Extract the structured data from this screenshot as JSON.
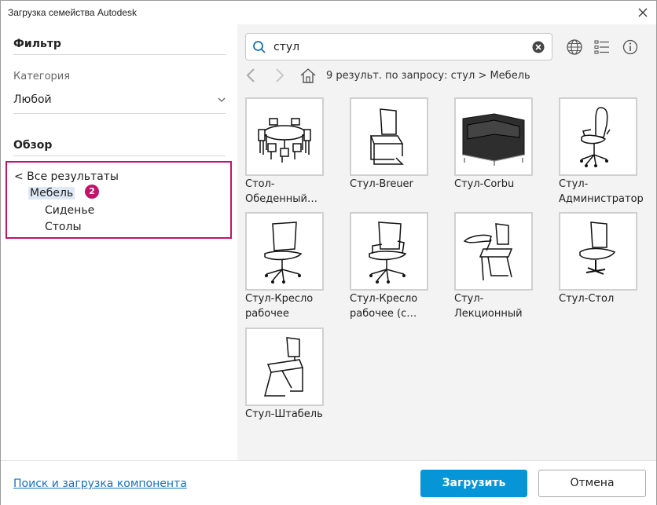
{
  "window": {
    "title": "Загрузка семейства Autodesk"
  },
  "filter": {
    "heading": "Фильтр",
    "category_label": "Категория",
    "category_value": "Любой"
  },
  "browse": {
    "heading": "Обзор",
    "all_results": "< Все результаты",
    "selected": "Мебель",
    "badge": "2",
    "children": [
      "Сиденье",
      "Столы"
    ]
  },
  "search": {
    "value": "стул",
    "placeholder": ""
  },
  "breadcrumb": "9 результ. по запросу: стул > Мебель",
  "results": [
    {
      "label": "Стол-Обеденный…",
      "icon": "dining-table"
    },
    {
      "label": "Стул-Breuer",
      "icon": "breuer-chair"
    },
    {
      "label": "Стул-Corbu",
      "icon": "corbu-armchair"
    },
    {
      "label": "Стул-Администратор",
      "icon": "admin-chair"
    },
    {
      "label": "Стул-Кресло рабочее",
      "icon": "task-chair"
    },
    {
      "label": "Стул-Кресло рабочее (с…",
      "icon": "task-chair-arms"
    },
    {
      "label": "Стул-Лекционный",
      "icon": "lecture-chair"
    },
    {
      "label": "Стул-Стол",
      "icon": "desk-chair"
    },
    {
      "label": "Стул-Штабель",
      "icon": "stacking-chair"
    }
  ],
  "footer": {
    "link": "Поиск и загрузка компонента",
    "load_button": "Загрузить",
    "cancel_button": "Отмена"
  },
  "colors": {
    "accent": "#0696d7",
    "highlight": "#c3126a",
    "selection": "#dfe9f6"
  }
}
